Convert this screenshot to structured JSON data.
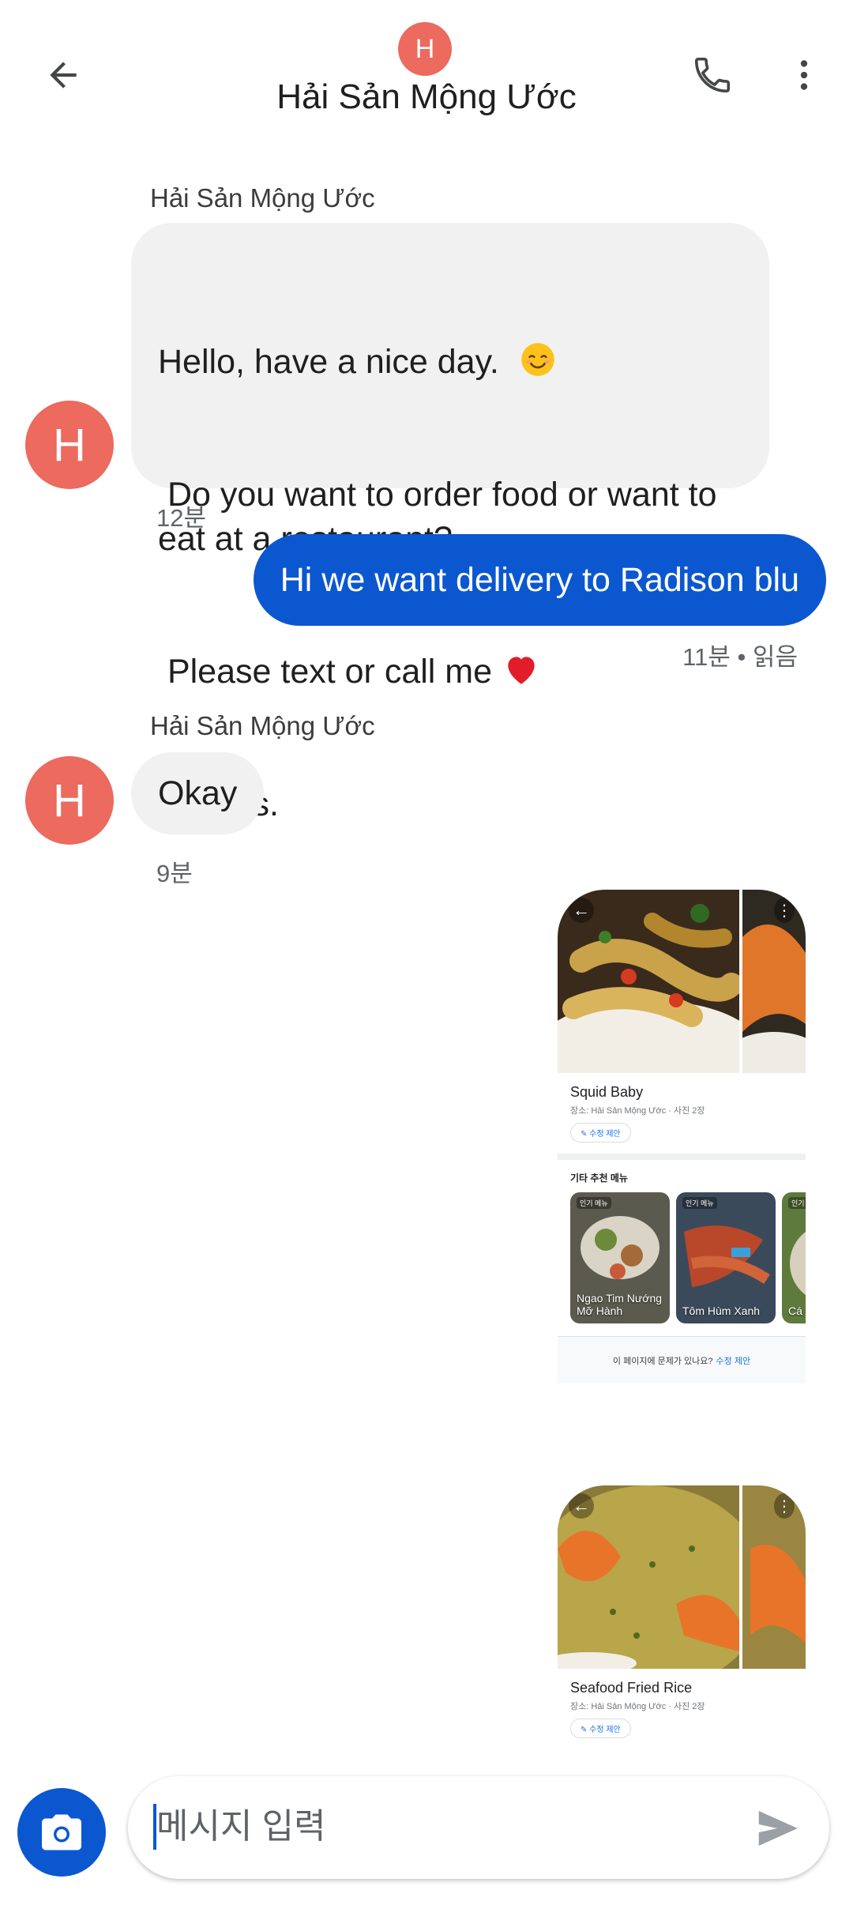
{
  "header": {
    "avatar_letter": "H",
    "contact_name": "Hải Sản Mộng Ước"
  },
  "messages": {
    "m1": {
      "sender": "Hải Sản Mộng Ước",
      "avatar_letter": "H",
      "line1": "Hello, have a nice day.",
      "line2": " Do you want to order food or want to eat at a restaurant?",
      "line3": " Please text or call me",
      "line4": "Thanks.",
      "time": "12분"
    },
    "m2": {
      "text": "Hi we want delivery to Radison blu",
      "time": "11분 • 읽음"
    },
    "m3": {
      "sender": "Hải Sản Mộng Ước",
      "avatar_letter": "H",
      "text": "Okay",
      "time": "9분"
    },
    "card1": {
      "title": "Squid Baby",
      "subtitle": "장소: Hải Sản Mộng Ước · 사진 2장",
      "chip": "수정 제안",
      "section": "기타 추천 메뉴",
      "thumbs": [
        {
          "tag": "인기 메뉴",
          "caption": "Ngao Tim Nướng Mỡ Hành"
        },
        {
          "tag": "인기 메뉴",
          "caption": "Tôm Hùm Xanh"
        },
        {
          "tag": "인기",
          "caption": "Cá C"
        }
      ],
      "report": "이 페이지에 문제가 있나요?",
      "report_link": "수정 제안"
    },
    "card2": {
      "title": "Seafood Fried Rice",
      "subtitle": "장소: Hải Sản Mộng Ước · 사진 2장",
      "chip": "수정 제안"
    }
  },
  "composer": {
    "placeholder": "메시지 입력"
  },
  "colors": {
    "accent": "#0b57d0",
    "avatar": "#ec6a5e",
    "incoming_bubble": "#f1f1f1"
  },
  "icons": [
    "back-arrow-icon",
    "phone-icon",
    "more-vert-icon",
    "camera-icon",
    "send-icon",
    "smile-emoji-icon",
    "heart-emoji-icon"
  ]
}
